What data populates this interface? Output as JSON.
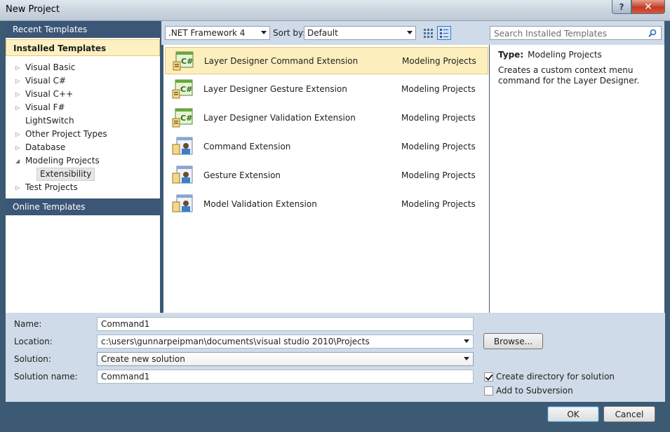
{
  "window": {
    "title": "New Project",
    "help_label": "?",
    "close_label": "✕"
  },
  "left": {
    "recent": "Recent Templates",
    "installed": "Installed Templates",
    "online": "Online Templates",
    "tree": [
      {
        "label": "Visual Basic",
        "arrow": "▷"
      },
      {
        "label": "Visual C#",
        "arrow": "▷"
      },
      {
        "label": "Visual C++",
        "arrow": "▷"
      },
      {
        "label": "Visual F#",
        "arrow": "▷"
      },
      {
        "label": "LightSwitch",
        "arrow": ""
      },
      {
        "label": "Other Project Types",
        "arrow": "▷"
      },
      {
        "label": "Database",
        "arrow": "▷"
      },
      {
        "label": "Modeling Projects",
        "arrow": "◢"
      },
      {
        "label": "Extensibility",
        "arrow": ""
      },
      {
        "label": "Test Projects",
        "arrow": "▷"
      }
    ]
  },
  "toolbar": {
    "framework": ".NET Framework 4",
    "sort_label": "Sort by:",
    "sort_value": "Default"
  },
  "search": {
    "placeholder": "Search Installed Templates"
  },
  "templates": [
    {
      "name": "Layer Designer Command Extension",
      "category": "Modeling Projects",
      "icon": "csharp-project-icon"
    },
    {
      "name": "Layer Designer Gesture Extension",
      "category": "Modeling Projects",
      "icon": "csharp-project-icon"
    },
    {
      "name": "Layer Designer Validation Extension",
      "category": "Modeling Projects",
      "icon": "csharp-project-icon"
    },
    {
      "name": "Command Extension",
      "category": "Modeling Projects",
      "icon": "modeling-project-icon"
    },
    {
      "name": "Gesture Extension",
      "category": "Modeling Projects",
      "icon": "modeling-project-icon"
    },
    {
      "name": "Model Validation Extension",
      "category": "Modeling Projects",
      "icon": "modeling-project-icon"
    }
  ],
  "details": {
    "type_label": "Type:",
    "type_value": "Modeling Projects",
    "description": "Creates a custom context menu command for the Layer Designer."
  },
  "form": {
    "name_label": "Name:",
    "name_value": "Command1",
    "location_label": "Location:",
    "location_value": "c:\\users\\gunnarpeipman\\documents\\visual studio 2010\\Projects",
    "solution_label": "Solution:",
    "solution_value": "Create new solution",
    "solution_name_label": "Solution name:",
    "solution_name_value": "Command1",
    "browse_label": "Browse...",
    "create_dir_label": "Create directory for solution",
    "add_svn_label": "Add to Subversion"
  },
  "buttons": {
    "ok": "OK",
    "cancel": "Cancel"
  },
  "colors": {
    "frame": "#3c5a74",
    "selection": "#fdefbd",
    "panel": "#cfdbe8"
  }
}
